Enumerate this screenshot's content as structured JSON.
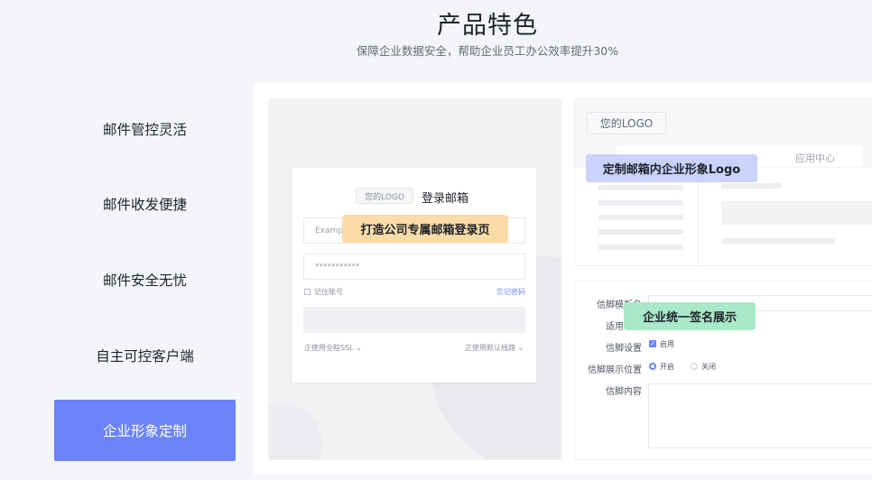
{
  "header": {
    "title": "产品特色",
    "subtitle": "保障企业数据安全，帮助企业员工办公效率提升30%"
  },
  "nav": {
    "items": [
      {
        "label": "邮件管控灵活"
      },
      {
        "label": "邮件收发便捷"
      },
      {
        "label": "邮件安全无忧"
      },
      {
        "label": "自主可控客户端"
      },
      {
        "label": "企业形象定制"
      }
    ],
    "active_index": 4
  },
  "login_preview": {
    "logo_text": "您的LOGO",
    "heading": "登录邮箱",
    "username_placeholder": "Example",
    "password_mask": "***********",
    "remember_label": "记住账号",
    "forgot_label": "忘记密码",
    "ssl_label": "正使用全程SSL",
    "route_label": "正使用默认线路",
    "callout": "打造公司专属邮箱登录页"
  },
  "mailbox_preview": {
    "logo_text": "您的LOGO",
    "tab_app_center": "应用中心",
    "callout": "定制邮箱内企业形象Logo"
  },
  "signature_preview": {
    "callout": "企业统一签名展示",
    "template_label": "信脚模板名",
    "apply_label": "适用",
    "setting_label": "信脚设置",
    "enable_label": "启用",
    "position_label": "信脚展示位置",
    "on_label": "开启",
    "off_label": "关闭",
    "content_label": "信脚内容"
  },
  "colors": {
    "accent": "#6b83fb",
    "orange_tag": "#fcdca6",
    "blue_tag": "#c9d3fb",
    "green_tag": "#a9e8c8"
  }
}
